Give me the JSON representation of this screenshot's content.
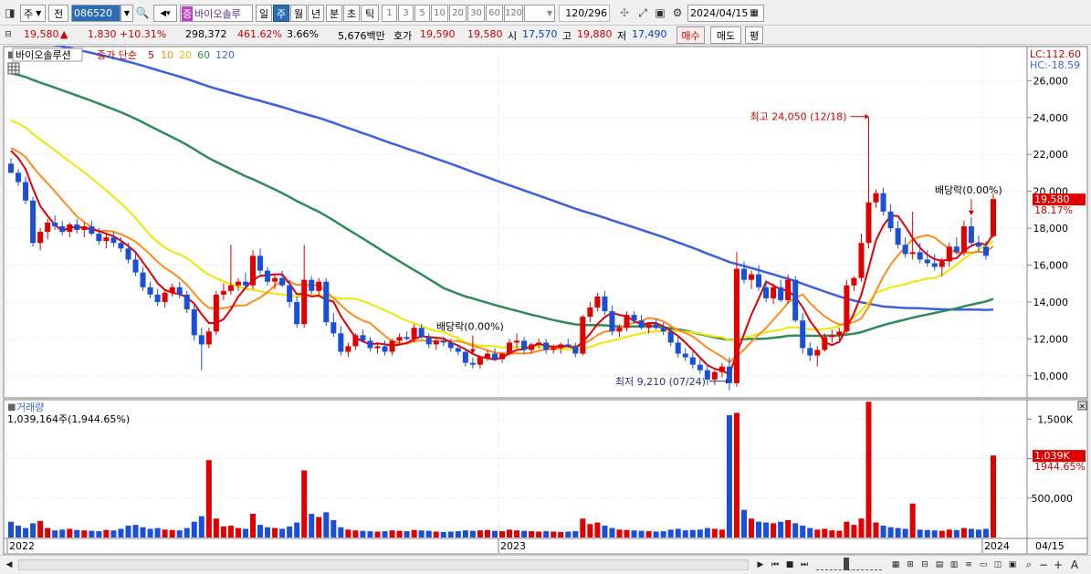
{
  "toolbar": {
    "market": "주",
    "prev_label": "전",
    "code": "086520",
    "stock_name": "바이오솔루",
    "badge": "증",
    "period_day": "일",
    "period_week": "주",
    "period_month": "월",
    "period_year": "년",
    "period_min": "분",
    "period_sec": "초",
    "period_tick": "틱",
    "nums": [
      "1",
      "3",
      "5",
      "10",
      "20",
      "30",
      "60",
      "120"
    ],
    "count": "120",
    "total": "/296",
    "date": "2024/04/15"
  },
  "quote": {
    "price": "19,580",
    "change": "1,830",
    "change_pct": "+10.31%",
    "volume": "298,372",
    "vol_ratio": "461.62%",
    "turnover": "3.66%",
    "amount": "5,676백만",
    "bid_label": "호가",
    "bid1": "19,590",
    "bid2": "19,580",
    "open_label": "시",
    "open": "17,570",
    "high_label": "고",
    "high": "19,880",
    "low_label": "저",
    "low": "17,490",
    "buy_btn": "매수",
    "sell_btn": "매도",
    "eval_btn": "평"
  },
  "chart": {
    "stock_label": "바이오솔루션",
    "ma_label": "종가 단순",
    "ma_periods": [
      "5",
      "10",
      "20",
      "60",
      "120"
    ],
    "ma_colors": [
      "#e00000",
      "#ff8c1a",
      "#f2e600",
      "#2e8b57",
      "#3a5fe0"
    ],
    "lc": "LC:112.60",
    "hc": "HC:-18.59",
    "price_ticks": [
      "26,000",
      "24,000",
      "22,000",
      "20,000",
      "18,000",
      "16,000",
      "14,000",
      "12,000",
      "10,000"
    ],
    "current_price_tag": "19,580",
    "current_pct_tag": "18.17%",
    "high_annotation": "최고 24,050 (12/18)",
    "low_annotation": "최저 9,210 (07/24)",
    "dividend_label_1": "배당락(0.00%)",
    "dividend_label_2": "배당락(0.00%)",
    "volume_title": "거래량",
    "volume_value": "1,039,164주(1,944.65%)",
    "volume_ticks": [
      "1,500K",
      "1,000K",
      "500,000"
    ],
    "volume_tag": "1,039K",
    "volume_pct_tag": "1944.65%",
    "x_labels": [
      "2022",
      "2023",
      "2024"
    ],
    "x_last": "04/15"
  },
  "chart_data": {
    "type": "candlestick",
    "ylim": [
      9000,
      27500
    ],
    "volume_ylim": [
      0,
      1700000
    ],
    "candles": [
      [
        21500,
        21800,
        21000,
        21000,
        200000
      ],
      [
        21000,
        21200,
        20300,
        20500,
        150000
      ],
      [
        20500,
        20800,
        19300,
        19500,
        120000
      ],
      [
        19500,
        19700,
        17000,
        17200,
        180000
      ],
      [
        17200,
        18000,
        16800,
        17800,
        210000
      ],
      [
        17800,
        18500,
        17400,
        18300,
        120000
      ],
      [
        18300,
        18700,
        17900,
        18100,
        90000
      ],
      [
        18100,
        18400,
        17600,
        17800,
        100000
      ],
      [
        17800,
        18300,
        17500,
        18200,
        110000
      ],
      [
        18200,
        18500,
        17700,
        17900,
        95000
      ],
      [
        17900,
        18300,
        17500,
        18100,
        90000
      ],
      [
        18100,
        18400,
        17600,
        17700,
        85000
      ],
      [
        17700,
        18000,
        17100,
        17300,
        80000
      ],
      [
        17300,
        17700,
        16900,
        17500,
        95000
      ],
      [
        17500,
        17800,
        17000,
        17200,
        90000
      ],
      [
        17200,
        17500,
        16700,
        16900,
        110000
      ],
      [
        16900,
        17200,
        16100,
        16300,
        150000
      ],
      [
        16300,
        16700,
        15400,
        15600,
        160000
      ],
      [
        15600,
        15900,
        14600,
        14800,
        130000
      ],
      [
        14800,
        15100,
        14200,
        14400,
        110000
      ],
      [
        14400,
        14700,
        13800,
        14000,
        120000
      ],
      [
        14000,
        14700,
        13700,
        14500,
        100000
      ],
      [
        14500,
        15000,
        14300,
        14800,
        95000
      ],
      [
        14800,
        15100,
        14200,
        14400,
        90000
      ],
      [
        14400,
        14600,
        13400,
        13600,
        120000
      ],
      [
        13600,
        13900,
        11900,
        12200,
        200000
      ],
      [
        12200,
        12600,
        10300,
        11700,
        270000
      ],
      [
        11700,
        12600,
        11500,
        12400,
        980000
      ],
      [
        12400,
        14600,
        12200,
        14400,
        240000
      ],
      [
        14400,
        15000,
        14100,
        14600,
        140000
      ],
      [
        14600,
        17100,
        14400,
        14900,
        150000
      ],
      [
        14900,
        15300,
        14600,
        15100,
        120000
      ],
      [
        15100,
        15600,
        14700,
        14900,
        110000
      ],
      [
        14900,
        16800,
        14700,
        16500,
        300000
      ],
      [
        16500,
        16900,
        15500,
        15700,
        160000
      ],
      [
        15700,
        15900,
        14900,
        15100,
        130000
      ],
      [
        15100,
        15500,
        14700,
        15300,
        120000
      ],
      [
        15300,
        15700,
        14800,
        14900,
        110000
      ],
      [
        14900,
        15200,
        13700,
        14000,
        140000
      ],
      [
        14000,
        14300,
        12600,
        12800,
        190000
      ],
      [
        12800,
        17100,
        12600,
        15200,
        850000
      ],
      [
        15200,
        15400,
        14400,
        14600,
        300000
      ],
      [
        14600,
        15300,
        14300,
        15100,
        260000
      ],
      [
        15100,
        15300,
        12700,
        12900,
        320000
      ],
      [
        12900,
        13400,
        12100,
        12300,
        220000
      ],
      [
        12300,
        12700,
        11100,
        11300,
        130000
      ],
      [
        11300,
        11800,
        11000,
        11600,
        100000
      ],
      [
        11600,
        12300,
        11400,
        12200,
        90000
      ],
      [
        12200,
        12500,
        11800,
        11900,
        85000
      ],
      [
        11900,
        12100,
        11300,
        11500,
        80000
      ],
      [
        11500,
        11800,
        11200,
        11600,
        75000
      ],
      [
        11600,
        11900,
        11100,
        11300,
        80000
      ],
      [
        11300,
        12000,
        11100,
        11900,
        90000
      ],
      [
        11900,
        12300,
        11700,
        12100,
        85000
      ],
      [
        12100,
        12400,
        11900,
        12000,
        80000
      ],
      [
        12000,
        12800,
        11800,
        12600,
        95000
      ],
      [
        12600,
        12800,
        12000,
        12100,
        90000
      ],
      [
        12100,
        12300,
        11500,
        11700,
        85000
      ],
      [
        11700,
        12000,
        11400,
        11900,
        75000
      ],
      [
        11900,
        12100,
        11600,
        11800,
        70000
      ],
      [
        11800,
        12000,
        11300,
        11500,
        75000
      ],
      [
        11500,
        11700,
        11100,
        11300,
        80000
      ],
      [
        11300,
        11500,
        10500,
        10700,
        90000
      ],
      [
        10700,
        11000,
        10400,
        10600,
        85000
      ],
      [
        10600,
        11100,
        10400,
        11000,
        90000
      ],
      [
        11000,
        11400,
        10800,
        11200,
        95000
      ],
      [
        11200,
        11500,
        10800,
        10900,
        85000
      ],
      [
        10900,
        11300,
        10700,
        11200,
        80000
      ],
      [
        11200,
        12000,
        11100,
        11800,
        100000
      ],
      [
        11800,
        12300,
        11500,
        11900,
        90000
      ],
      [
        11900,
        12100,
        11200,
        11400,
        85000
      ],
      [
        11400,
        11800,
        11200,
        11700,
        80000
      ],
      [
        11700,
        12000,
        11500,
        11800,
        75000
      ],
      [
        11800,
        12000,
        11200,
        11400,
        80000
      ],
      [
        11400,
        11700,
        11200,
        11500,
        75000
      ],
      [
        11500,
        11800,
        11200,
        11700,
        70000
      ],
      [
        11700,
        12000,
        11500,
        11600,
        75000
      ],
      [
        11600,
        11800,
        11000,
        11200,
        80000
      ],
      [
        11200,
        13300,
        11100,
        13200,
        240000
      ],
      [
        13200,
        14000,
        12900,
        13700,
        170000
      ],
      [
        13700,
        14500,
        13500,
        14300,
        190000
      ],
      [
        14300,
        14600,
        13300,
        13500,
        150000
      ],
      [
        13500,
        13800,
        12200,
        12400,
        120000
      ],
      [
        12400,
        12800,
        12100,
        12600,
        100000
      ],
      [
        12600,
        13500,
        12400,
        13300,
        95000
      ],
      [
        13300,
        13500,
        12800,
        13000,
        90000
      ],
      [
        13000,
        13300,
        12500,
        12600,
        85000
      ],
      [
        12600,
        12900,
        12300,
        12800,
        80000
      ],
      [
        12800,
        13100,
        12500,
        12600,
        75000
      ],
      [
        12600,
        12900,
        12200,
        12400,
        80000
      ],
      [
        12400,
        12600,
        11600,
        11800,
        100000
      ],
      [
        11800,
        12100,
        11000,
        11200,
        110000
      ],
      [
        11200,
        11500,
        10800,
        11000,
        90000
      ],
      [
        11000,
        11300,
        10400,
        10600,
        95000
      ],
      [
        10600,
        10900,
        10100,
        10300,
        100000
      ],
      [
        10300,
        10600,
        9500,
        9800,
        120000
      ],
      [
        9800,
        10300,
        9500,
        10200,
        110000
      ],
      [
        10200,
        10700,
        9900,
        10500,
        100000
      ],
      [
        10500,
        11000,
        9210,
        9600,
        1550000
      ],
      [
        9600,
        16700,
        9400,
        15800,
        1580000
      ],
      [
        15800,
        16200,
        15000,
        15200,
        350000
      ],
      [
        15200,
        15700,
        14700,
        15500,
        240000
      ],
      [
        15500,
        16000,
        14600,
        14800,
        200000
      ],
      [
        14800,
        15200,
        14000,
        14200,
        190000
      ],
      [
        14200,
        15000,
        13900,
        14800,
        180000
      ],
      [
        14800,
        15200,
        14000,
        14100,
        200000
      ],
      [
        14100,
        15500,
        13900,
        15200,
        220000
      ],
      [
        15200,
        15400,
        12900,
        13000,
        180000
      ],
      [
        13000,
        13400,
        11200,
        11500,
        150000
      ],
      [
        11500,
        11800,
        10800,
        11100,
        120000
      ],
      [
        11100,
        11600,
        10500,
        11400,
        100000
      ],
      [
        11400,
        12300,
        11300,
        12100,
        110000
      ],
      [
        12100,
        12500,
        11800,
        12200,
        90000
      ],
      [
        12200,
        12600,
        11900,
        12400,
        85000
      ],
      [
        12400,
        15200,
        12300,
        14900,
        200000
      ],
      [
        14900,
        15400,
        14600,
        15300,
        160000
      ],
      [
        15300,
        17700,
        15100,
        17200,
        240000
      ],
      [
        17200,
        24050,
        16900,
        19400,
        1720000
      ],
      [
        19400,
        20100,
        19100,
        19900,
        190000
      ],
      [
        19900,
        20200,
        18700,
        18900,
        150000
      ],
      [
        18900,
        19300,
        17800,
        18000,
        130000
      ],
      [
        18000,
        18400,
        16900,
        17100,
        120000
      ],
      [
        17100,
        17500,
        16400,
        16600,
        110000
      ],
      [
        16600,
        18900,
        16300,
        16700,
        430000
      ],
      [
        16700,
        17200,
        16100,
        16300,
        100000
      ],
      [
        16300,
        16800,
        15900,
        16100,
        95000
      ],
      [
        16100,
        16600,
        15700,
        15900,
        90000
      ],
      [
        15900,
        16400,
        15400,
        16200,
        85000
      ],
      [
        16200,
        17200,
        15900,
        17000,
        100000
      ],
      [
        17000,
        17500,
        16600,
        16700,
        95000
      ],
      [
        16700,
        18400,
        16500,
        18100,
        120000
      ],
      [
        18100,
        18600,
        17000,
        17200,
        110000
      ],
      [
        17200,
        17600,
        16700,
        17000,
        100000
      ],
      [
        17000,
        17300,
        16300,
        16500,
        110000
      ],
      [
        17570,
        19880,
        17490,
        19580,
        1039164
      ]
    ]
  }
}
